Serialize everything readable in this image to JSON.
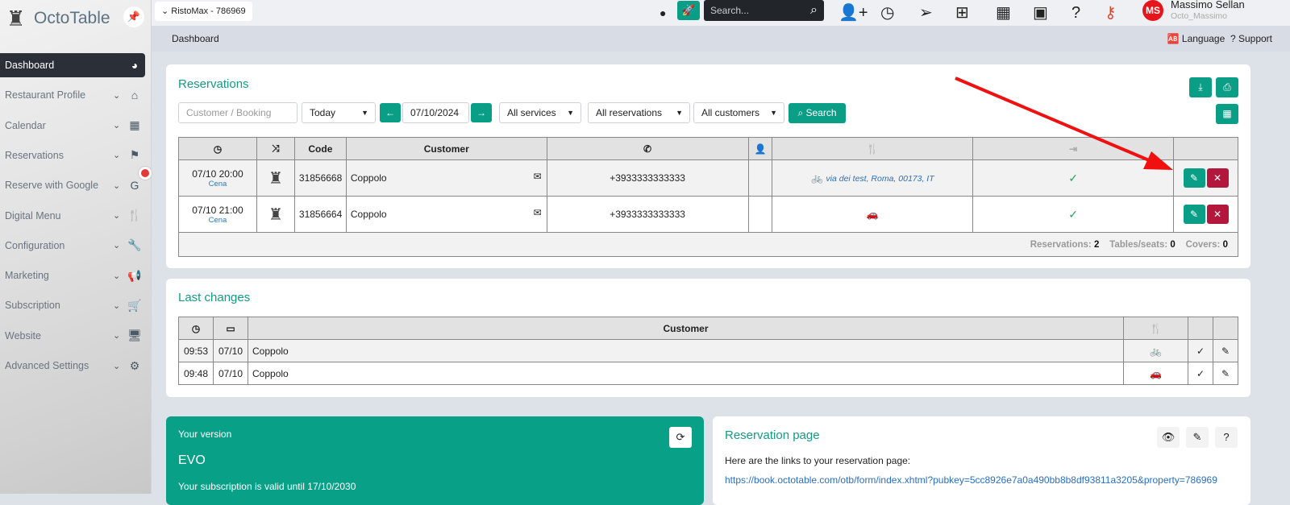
{
  "app": {
    "name": "OctoTable",
    "restaurant_selector": "RistoMax - 786969"
  },
  "sidebar": {
    "items": [
      {
        "label": "Dashboard",
        "icon": "dashboard-icon",
        "glyph": "◕"
      },
      {
        "label": "Restaurant Profile",
        "icon": "home-icon",
        "glyph": "⌂"
      },
      {
        "label": "Calendar",
        "icon": "calendar-icon",
        "glyph": "▦"
      },
      {
        "label": "Reservations",
        "icon": "flag-icon",
        "glyph": "⚑"
      },
      {
        "label": "Reserve with Google",
        "icon": "google-icon",
        "glyph": "G"
      },
      {
        "label": "Digital Menu",
        "icon": "utensils-icon",
        "glyph": "🍴"
      },
      {
        "label": "Configuration",
        "icon": "wrench-icon",
        "glyph": "🔧"
      },
      {
        "label": "Marketing",
        "icon": "megaphone-icon",
        "glyph": "📢"
      },
      {
        "label": "Subscription",
        "icon": "cart-icon",
        "glyph": "🛒"
      },
      {
        "label": "Website",
        "icon": "monitor-icon",
        "glyph": "🖥"
      },
      {
        "label": "Advanced Settings",
        "icon": "cogs-icon",
        "glyph": "⚙"
      }
    ]
  },
  "topbar": {
    "search_placeholder": "Search...",
    "user_name": "Massimo Sellan",
    "user_login": "Octo_Massimo",
    "avatar_initials": "MS"
  },
  "breadcrumb": {
    "current": "Dashboard",
    "language": "Language",
    "support": "? Support"
  },
  "reservations": {
    "title": "Reservations",
    "filters": {
      "customer_placeholder": "Customer / Booking",
      "day": "Today",
      "date": "07/10/2024",
      "services": "All services",
      "reservations": "All reservations",
      "customers": "All customers",
      "search": "Search"
    },
    "columns": {
      "code": "Code",
      "customer": "Customer"
    },
    "rows": [
      {
        "datetime": "07/10 20:00",
        "service": "Cena",
        "code": "31856668",
        "customer": "Coppolo",
        "phone": "+3933333333333",
        "delivery": "via dei test, Roma, 00173, IT"
      },
      {
        "datetime": "07/10 21:00",
        "service": "Cena",
        "code": "31856664",
        "customer": "Coppolo",
        "phone": "+3933333333333",
        "delivery": ""
      }
    ],
    "footer": {
      "reservations_label": "Reservations:",
      "reservations": "2",
      "tables_label": "Tables/seats:",
      "tables": "0",
      "covers_label": "Covers:",
      "covers": "0"
    }
  },
  "last_changes": {
    "title": "Last changes",
    "customer_header": "Customer",
    "rows": [
      {
        "time": "09:53",
        "date": "07/10",
        "customer": "Coppolo"
      },
      {
        "time": "09:48",
        "date": "07/10",
        "customer": "Coppolo"
      }
    ]
  },
  "version": {
    "label": "Your version",
    "name": "EVO",
    "subscription": "Your subscription is valid until 17/10/2030"
  },
  "reservation_page": {
    "title": "Reservation page",
    "text": "Here are the links to your reservation page:",
    "link": "https://book.octotable.com/otb/form/index.xhtml?pubkey=5cc8926e7a0a490bb8b8df93811a3205&property=786969"
  },
  "colors": {
    "accent": "#0a9e87",
    "danger": "#b3183c",
    "title": "#119c85"
  }
}
